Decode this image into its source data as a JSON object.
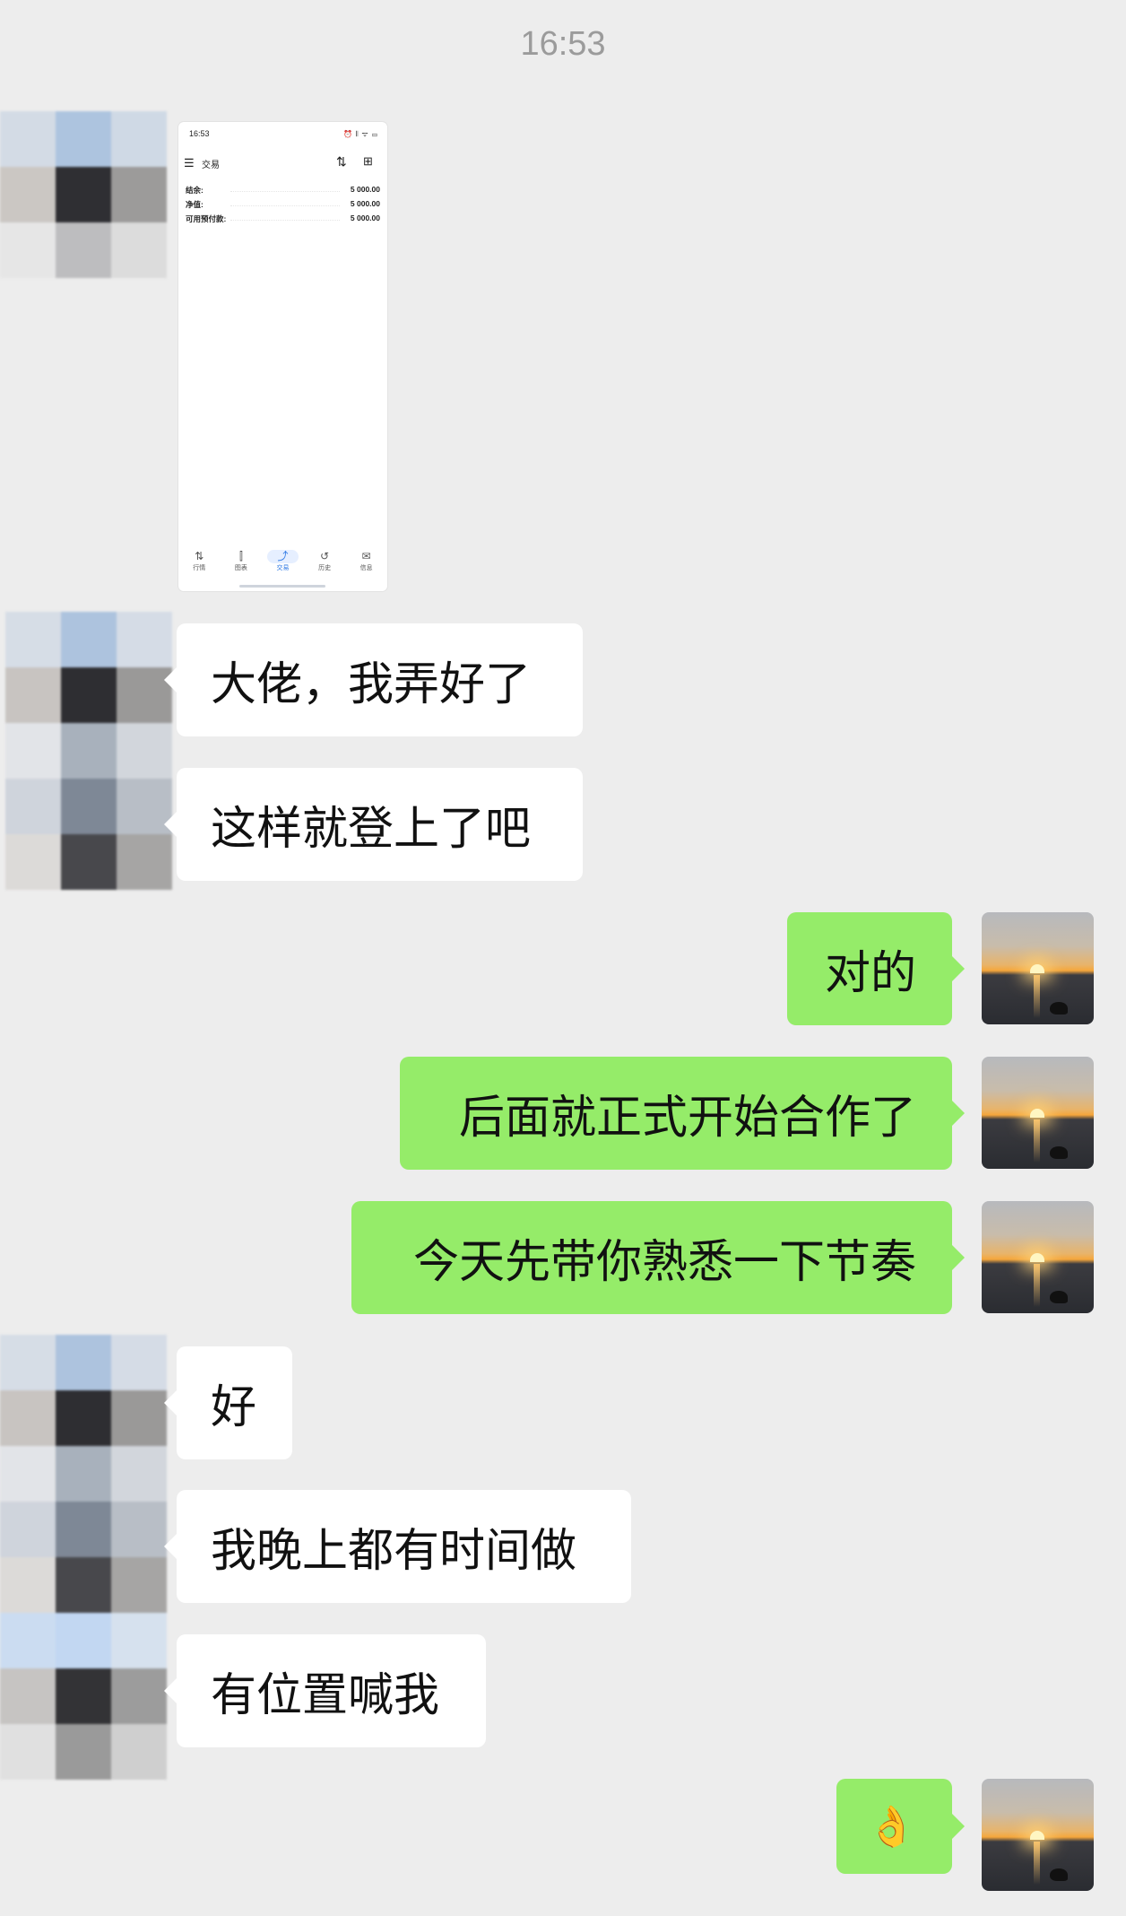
{
  "chat": {
    "timestamp": "16:53",
    "messages": [
      {
        "side": "left",
        "type": "image"
      },
      {
        "side": "left",
        "text": "大佬，我弄好了"
      },
      {
        "side": "left",
        "text": "这样就登上了吧"
      },
      {
        "side": "right",
        "text": "对的"
      },
      {
        "side": "right",
        "text": "后面就正式开始合作了"
      },
      {
        "side": "right",
        "text": "今天先带你熟悉一下节奏"
      },
      {
        "side": "left",
        "text": "好"
      },
      {
        "side": "left",
        "text": "我晚上都有时间做"
      },
      {
        "side": "left",
        "text": "有位置喊我"
      },
      {
        "side": "right",
        "text": "👌"
      }
    ]
  },
  "shared_screenshot": {
    "status_time": "16:53",
    "status_icons": "⏰ 𝄃 ᯤ ▭",
    "title": "交易",
    "rows": [
      {
        "label": "结余:",
        "value": "5 000.00"
      },
      {
        "label": "净值:",
        "value": "5 000.00"
      },
      {
        "label": "可用预付款:",
        "value": "5 000.00"
      }
    ],
    "nav": [
      {
        "icon": "⇅",
        "label": "行情"
      },
      {
        "icon": "⫿",
        "label": "图表"
      },
      {
        "icon": "⤴",
        "label": "交易"
      },
      {
        "icon": "↺",
        "label": "历史"
      },
      {
        "icon": "✉",
        "label": "信息"
      }
    ],
    "active_tab": "交易"
  },
  "colors": {
    "background": "#ededed",
    "incoming_bubble": "#ffffff",
    "outgoing_bubble": "#95ec69",
    "active_tab": "#2f7ae5"
  }
}
